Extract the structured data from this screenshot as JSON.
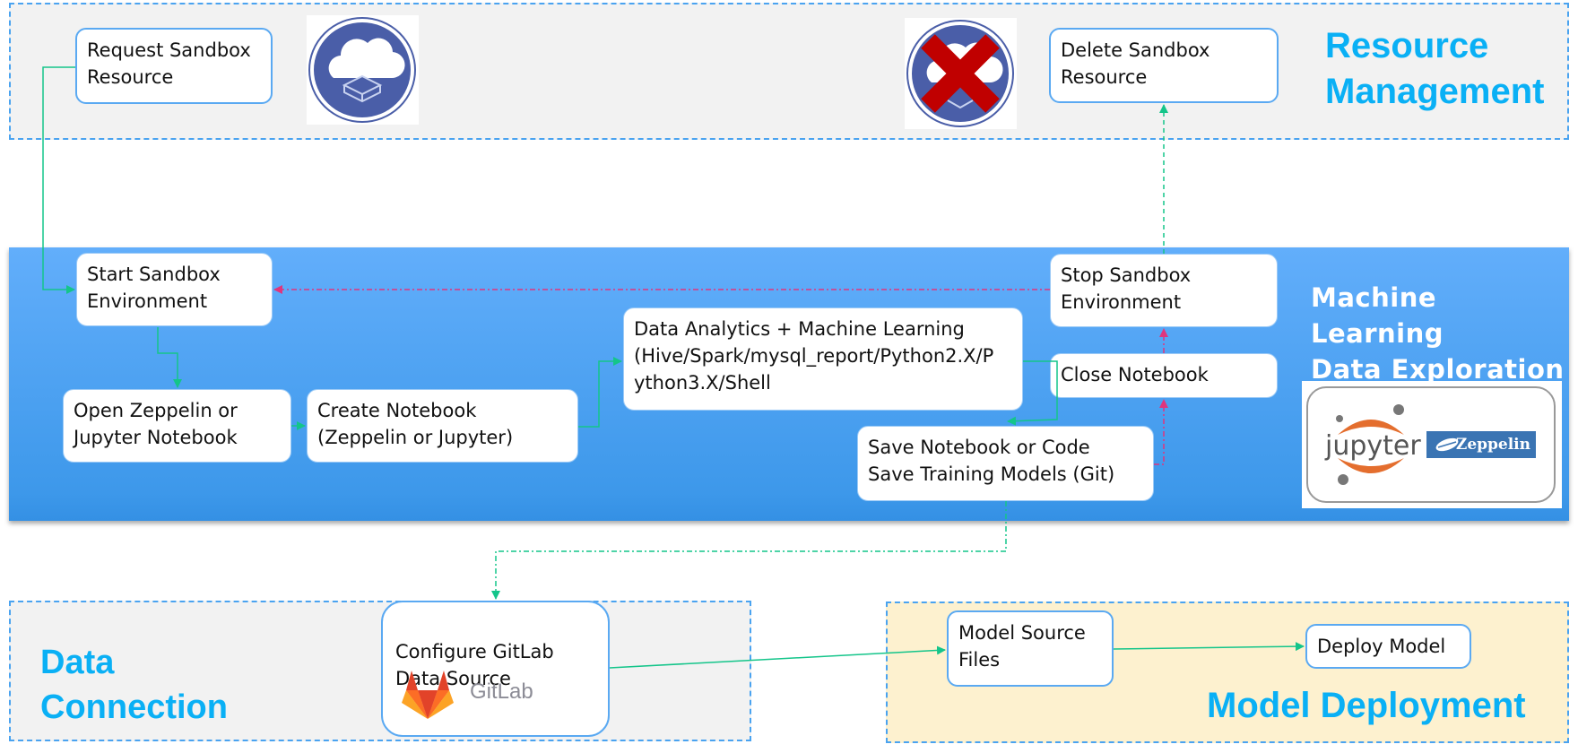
{
  "groups": {
    "resource_management": {
      "title": "Resource\nManagement"
    },
    "ml_exploration": {
      "title": "Machine Learning\nData Exploration"
    },
    "data_connection": {
      "title": "Data\nConnection"
    },
    "model_deployment": {
      "title": "Model Deployment"
    }
  },
  "nodes": {
    "request_sandbox": "Request Sandbox\nResource",
    "delete_sandbox": "Delete Sandbox\nResource",
    "start_sandbox": "Start Sandbox\nEnvironment",
    "stop_sandbox": "Stop Sandbox\nEnvironment",
    "close_notebook": "Close Notebook",
    "data_analytics": "Data Analytics + Machine Learning\n(Hive/Spark/mysql_report/Python2.X/P\nython3.X/Shell",
    "open_notebook": "Open Zeppelin or\nJupyter Notebook",
    "create_notebook": "Create Notebook\n(Zeppelin or Jupyter)",
    "save_notebook": "Save Notebook or Code\nSave Training Models (Git)",
    "configure_gitlab": "Configure GitLab\nData Source",
    "model_source": "Model Source\nFiles",
    "deploy_model": "Deploy Model"
  },
  "logos": {
    "jupyter": "jupyter",
    "zeppelin": "Zeppelin",
    "gitlab": "GitLab"
  },
  "icons": {
    "request": "cloud-sandbox-icon",
    "delete": "cloud-sandbox-delete-icon"
  },
  "colors": {
    "accent_blue": "#0ab0f5",
    "flow_green": "#14c58a",
    "flow_pink": "#e0357d",
    "group_border": "#4aa3f0",
    "delete_red": "#c00000",
    "icon_navy": "#4a5ea8"
  },
  "edges": [
    {
      "from": "Request Sandbox Resource",
      "to": "Start Sandbox Environment",
      "style": "solid-green"
    },
    {
      "from": "Start Sandbox Environment",
      "to": "Open Zeppelin or Jupyter Notebook",
      "style": "solid-green"
    },
    {
      "from": "Open Zeppelin or Jupyter Notebook",
      "to": "Create Notebook",
      "style": "solid-green"
    },
    {
      "from": "Create Notebook",
      "to": "Data Analytics + Machine Learning",
      "style": "solid-green"
    },
    {
      "from": "Data Analytics + Machine Learning",
      "to": "Save Notebook or Code",
      "style": "solid-green"
    },
    {
      "from": "Save Notebook or Code",
      "to": "Close Notebook",
      "style": "dashdot-pink"
    },
    {
      "from": "Close Notebook",
      "to": "Stop Sandbox Environment",
      "style": "dashdot-pink"
    },
    {
      "from": "Stop Sandbox Environment",
      "to": "Start Sandbox Environment",
      "style": "dashdot-pink"
    },
    {
      "from": "Stop Sandbox Environment",
      "to": "Delete Sandbox Resource",
      "style": "dashed-green"
    },
    {
      "from": "Save Notebook or Code",
      "to": "Configure GitLab Data Source",
      "style": "dashdot-green"
    },
    {
      "from": "Configure GitLab Data Source",
      "to": "Model Source Files",
      "style": "solid-green"
    },
    {
      "from": "Model Source Files",
      "to": "Deploy Model",
      "style": "solid-green"
    }
  ]
}
